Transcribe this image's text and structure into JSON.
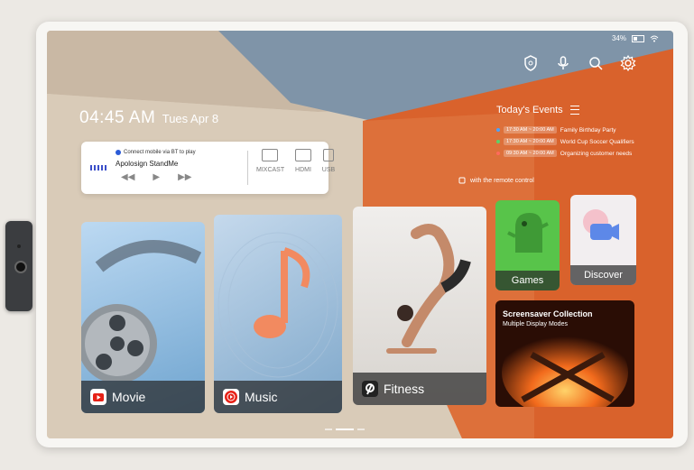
{
  "status": {
    "battery": "34%"
  },
  "clock": {
    "time": "04:45 AM",
    "date": "Tues Apr 8"
  },
  "media": {
    "prompt": "Connect mobile via BT to play",
    "device": "Apolosign StandMe",
    "sources": [
      "MIXCAST",
      "HDMI",
      "USB"
    ]
  },
  "events": {
    "title": "Today's Events",
    "items": [
      {
        "time": "17:30 AM ~ 20:00 AM",
        "name": "Family Birthday Party",
        "color": "#4aa3ff"
      },
      {
        "time": "17:30 AM ~ 20:00 AM",
        "name": "World Cup Soccer Qualifiers",
        "color": "#5bd16a"
      },
      {
        "time": "09:30 AM ~ 20:00 AM",
        "name": "Organizing customer needs",
        "color": "#ff6a5c"
      }
    ]
  },
  "remote_hint": "with the remote control",
  "tiles": {
    "movie": "Movie",
    "music": "Music",
    "fitness": "Fitness",
    "games": "Games",
    "discover": "Discover",
    "screensaver_title": "Screensaver Collection",
    "screensaver_sub": "Multiple Display Modes"
  },
  "colors": {
    "accent_orange": "#d9622c",
    "slate": "#7f94a8",
    "sand": "#d9cbb8"
  }
}
